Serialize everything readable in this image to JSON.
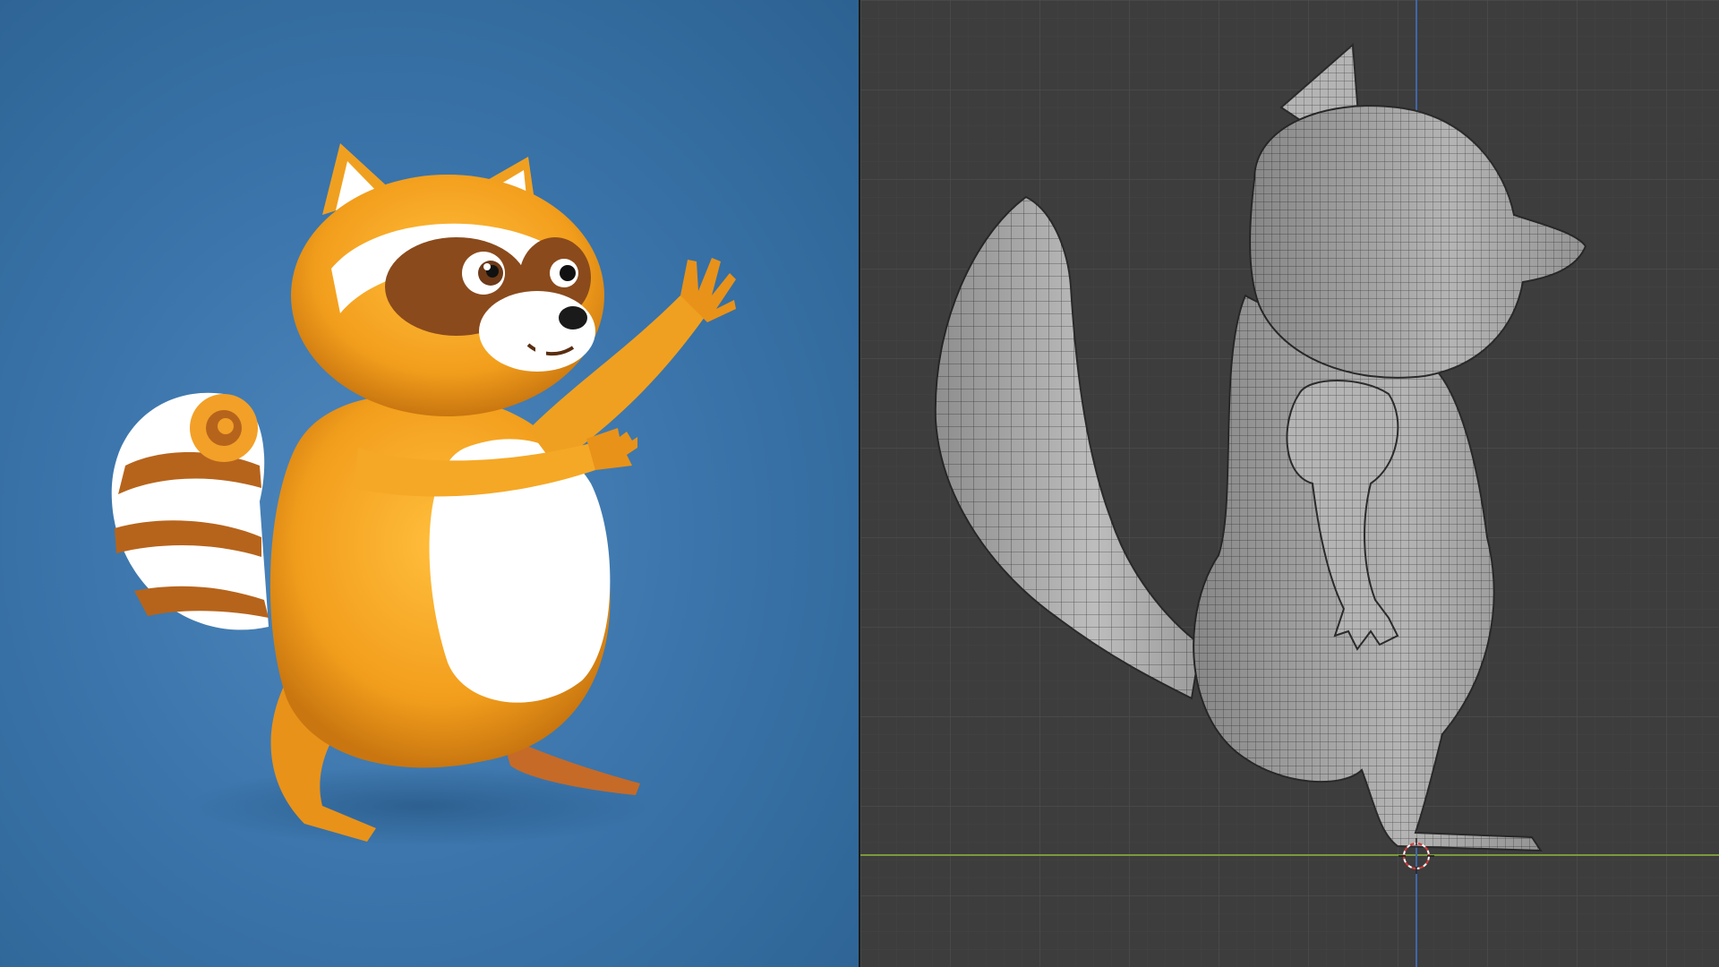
{
  "left_panel": {
    "kind": "render",
    "subject": "raccoon",
    "background_color": "#3b75ab",
    "fur_colors": [
      "#f0a320",
      "#ffffff",
      "#8a4a1c"
    ]
  },
  "right_panel": {
    "kind": "3d-viewport",
    "view": "side",
    "shading": "solid-wireframe",
    "background_color": "#3d3d3d",
    "grid_color": "#474747",
    "floor_axis_color": "#7a9a3c",
    "vertical_axis_color": "#3f67a8",
    "mesh_color": "#b9b9b9",
    "cursor_icon": "3d-cursor-icon"
  }
}
